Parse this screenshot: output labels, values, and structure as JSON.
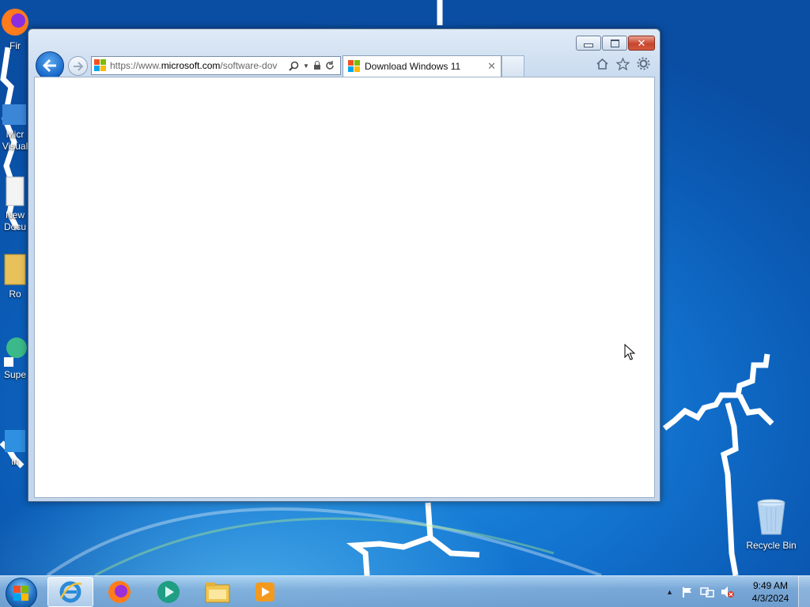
{
  "desktop": {
    "icons": [
      {
        "label": "Fir"
      },
      {
        "label": "Micr"
      },
      {
        "label": "Visual"
      },
      {
        "label": "New"
      },
      {
        "label": "Docu"
      },
      {
        "label": "Ro"
      },
      {
        "label": "Supe"
      },
      {
        "label": "in"
      }
    ],
    "recycle_bin": {
      "label": "Recycle Bin",
      "icon": "recycle-bin-icon"
    }
  },
  "browser": {
    "app": "Internet Explorer",
    "address_url": "https://www.microsoft.com/software-dov",
    "address_url_host": "microsoft.com",
    "tab_title": "Download Windows 11",
    "buttons": {
      "back": "back-arrow-icon",
      "forward": "forward-arrow-icon",
      "search": "search-icon",
      "lock": "lock-icon",
      "refresh": "refresh-icon",
      "home": "home-icon",
      "favorites": "star-icon",
      "tools": "gear-icon"
    }
  },
  "taskbar": {
    "pinned": [
      "internet-explorer-icon",
      "firefox-icon",
      "media-app-icon",
      "file-explorer-icon",
      "media-player-icon"
    ],
    "clock_time": "9:49 AM",
    "clock_date": "4/3/2024"
  },
  "colors": {
    "desktop_blue": "#1273cf",
    "close_red": "#c8452d"
  }
}
